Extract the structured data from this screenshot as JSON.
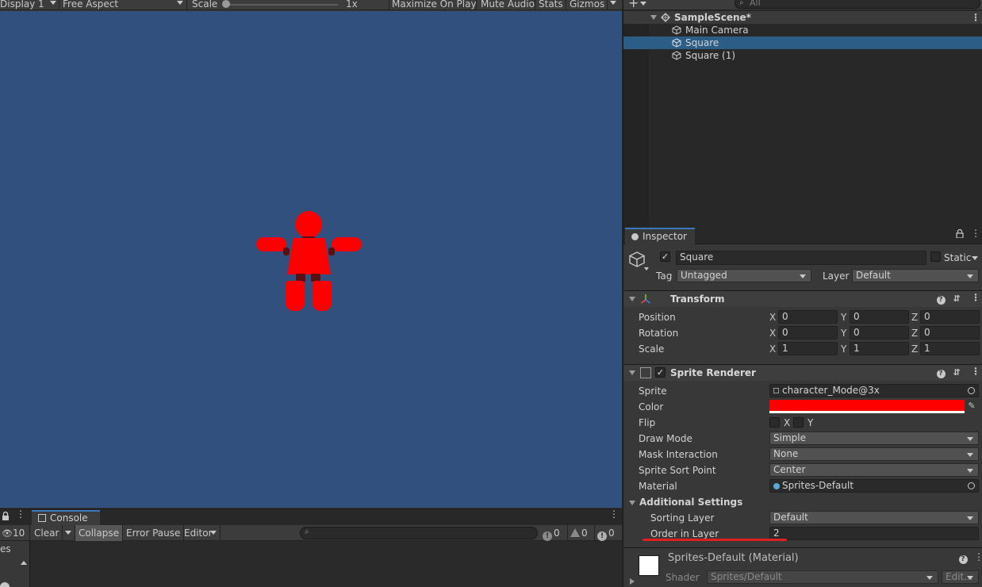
{
  "game_toolbar": {
    "display": "Display 1",
    "aspect": "Free Aspect",
    "scale_label": "Scale",
    "scale_value": "1x",
    "maximize": "Maximize On Play",
    "mute": "Mute Audio",
    "stats": "Stats",
    "gizmos": "Gizmos"
  },
  "hierarchy": {
    "search_placeholder": "All",
    "scene": "SampleScene*",
    "items": [
      "Main Camera",
      "Square",
      "Square (1)"
    ],
    "selected_index": 1
  },
  "inspector": {
    "tab": "Inspector",
    "object_name": "Square",
    "static_label": "Static",
    "tag_label": "Tag",
    "tag_value": "Untagged",
    "layer_label": "Layer",
    "layer_value": "Default",
    "transform": {
      "title": "Transform",
      "rows": [
        {
          "label": "Position",
          "x": "0",
          "y": "0",
          "z": "0"
        },
        {
          "label": "Rotation",
          "x": "0",
          "y": "0",
          "z": "0"
        },
        {
          "label": "Scale",
          "x": "1",
          "y": "1",
          "z": "1"
        }
      ],
      "axis_x": "X",
      "axis_y": "Y",
      "axis_z": "Z"
    },
    "sprite_renderer": {
      "title": "Sprite Renderer",
      "sprite_label": "Sprite",
      "sprite_value": "character_Mode@3x",
      "color_label": "Color",
      "color_value": "#ff0000",
      "flip_label": "Flip",
      "flip_x": "X",
      "flip_y": "Y",
      "draw_mode_label": "Draw Mode",
      "draw_mode_value": "Simple",
      "mask_label": "Mask Interaction",
      "mask_value": "None",
      "sort_point_label": "Sprite Sort Point",
      "sort_point_value": "Center",
      "material_label": "Material",
      "material_value": "Sprites-Default",
      "additional_settings": "Additional Settings",
      "sorting_layer_label": "Sorting Layer",
      "sorting_layer_value": "Default",
      "order_label": "Order in Layer",
      "order_value": "2"
    },
    "material": {
      "title": "Sprites-Default (Material)",
      "shader_label": "Shader",
      "shader_value": "Sprites/Default",
      "edit": "Edit..."
    }
  },
  "console": {
    "tab": "Console",
    "hidden_count": "10",
    "clear": "Clear",
    "collapse": "Collapse",
    "error_pause": "Error Pause",
    "editor": "Editor",
    "log_count": "0",
    "warn_count": "0",
    "error_count": "0",
    "side_label": "es"
  },
  "colors": {
    "accent": "#3a79bb",
    "selection": "#2c5d87",
    "game_background": "#31507e",
    "sprite": "#ff0000",
    "underline_annotation": "#e02020"
  }
}
